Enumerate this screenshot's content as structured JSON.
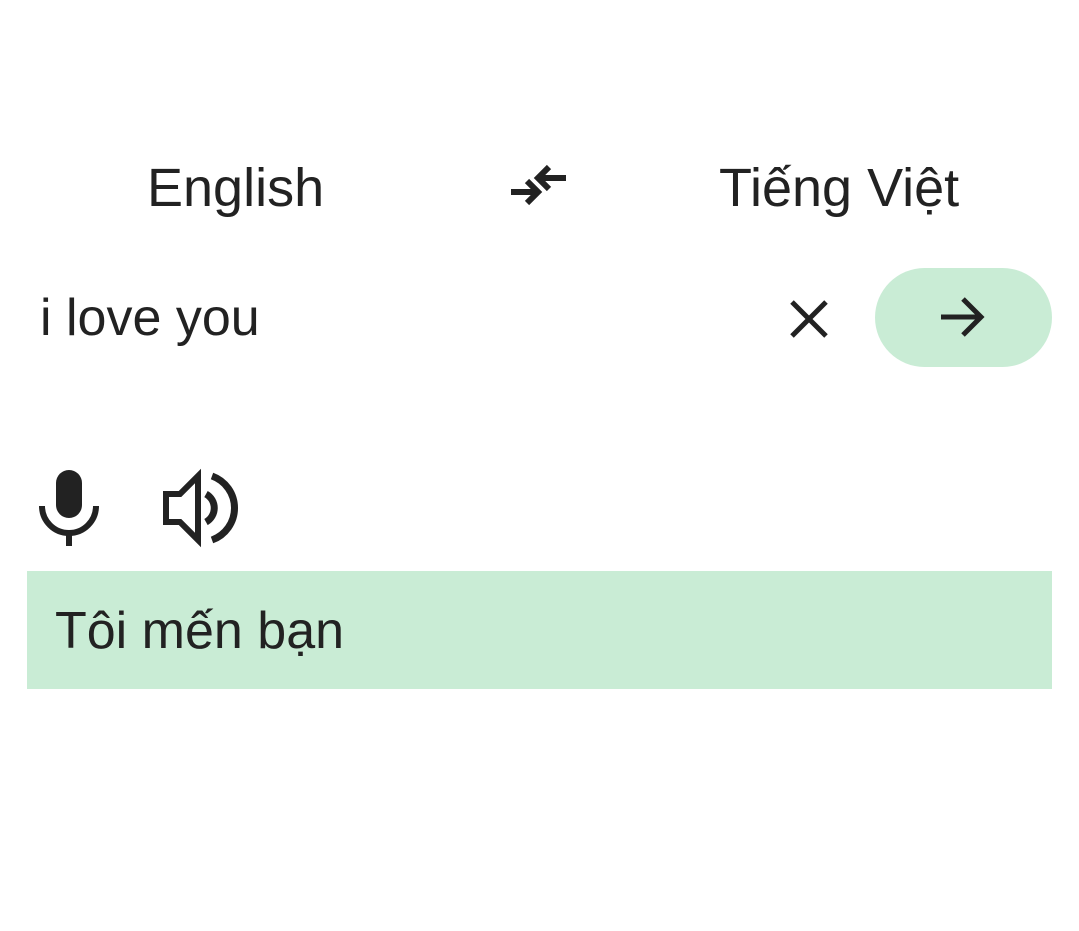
{
  "languages": {
    "source": "English",
    "target": "Tiếng Việt",
    "swap_icon": "swap-arrows-icon"
  },
  "input": {
    "value": "i love you",
    "placeholder": "",
    "clear_icon": "close-icon",
    "translate_icon": "arrow-right-icon"
  },
  "actions": {
    "mic_icon": "microphone-icon",
    "speaker_icon": "speaker-icon"
  },
  "result": {
    "text": "Tôi mến bạn"
  },
  "colors": {
    "accent": "#c9ecd5",
    "text": "#222222",
    "background": "#ffffff"
  }
}
